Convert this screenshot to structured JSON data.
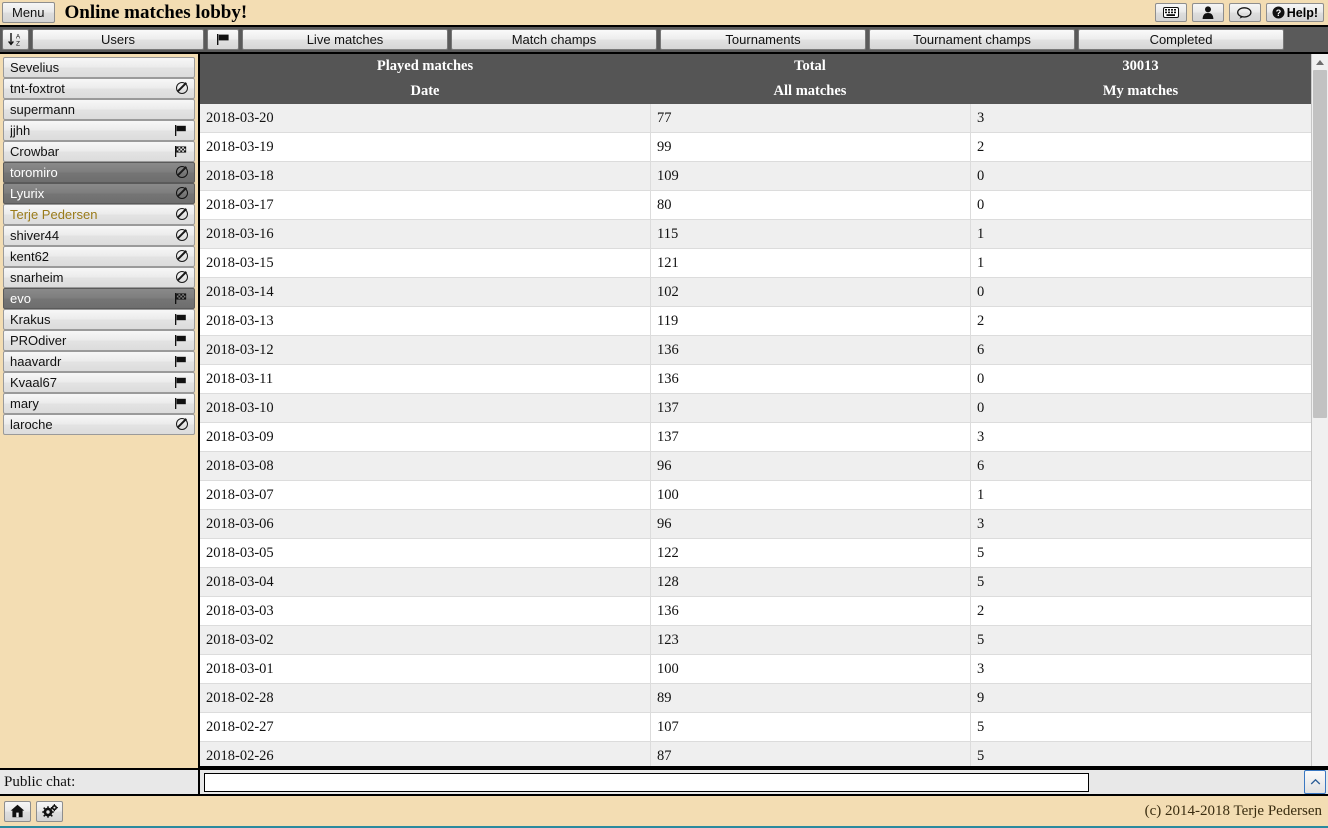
{
  "titlebar": {
    "menu_label": "Menu",
    "app_title": "Online matches lobby!",
    "help_label": "Help!",
    "icons": {
      "keyboard": "keyboard-icon",
      "user": "user-icon",
      "chat": "chat-bubble-icon",
      "help": "help-circle-icon"
    }
  },
  "tabs": {
    "sort_icon": "sort-alpha-down-icon",
    "users_label": "Users",
    "flag_icon": "flag-icon",
    "items": [
      {
        "label": "Live matches",
        "active": true
      },
      {
        "label": "Match champs",
        "active": false
      },
      {
        "label": "Tournaments",
        "active": false
      },
      {
        "label": "Tournament champs",
        "active": false
      },
      {
        "label": "Completed",
        "active": false
      }
    ]
  },
  "sidebar": {
    "users": [
      {
        "name": "Sevelius",
        "icon": "none",
        "selected": false,
        "highlight": false
      },
      {
        "name": "tnt-foxtrot",
        "icon": "no-entry",
        "selected": false,
        "highlight": false
      },
      {
        "name": "supermann",
        "icon": "none",
        "selected": false,
        "highlight": false
      },
      {
        "name": "jjhh",
        "icon": "flag",
        "selected": false,
        "highlight": false
      },
      {
        "name": "Crowbar",
        "icon": "checkered",
        "selected": false,
        "highlight": false
      },
      {
        "name": "toromiro",
        "icon": "no-entry",
        "selected": true,
        "highlight": false
      },
      {
        "name": "Lyurix",
        "icon": "no-entry",
        "selected": true,
        "highlight": false
      },
      {
        "name": "Terje Pedersen",
        "icon": "no-entry",
        "selected": false,
        "highlight": true
      },
      {
        "name": "shiver44",
        "icon": "no-entry",
        "selected": false,
        "highlight": false
      },
      {
        "name": "kent62",
        "icon": "no-entry",
        "selected": false,
        "highlight": false
      },
      {
        "name": "snarheim",
        "icon": "no-entry",
        "selected": false,
        "highlight": false
      },
      {
        "name": "evo",
        "icon": "checkered",
        "selected": true,
        "highlight": false
      },
      {
        "name": "Krakus",
        "icon": "flag",
        "selected": false,
        "highlight": false
      },
      {
        "name": "PROdiver",
        "icon": "flag",
        "selected": false,
        "highlight": false
      },
      {
        "name": "haavardr",
        "icon": "flag",
        "selected": false,
        "highlight": false
      },
      {
        "name": "Kvaal67",
        "icon": "flag",
        "selected": false,
        "highlight": false
      },
      {
        "name": "mary",
        "icon": "flag",
        "selected": false,
        "highlight": false
      },
      {
        "name": "laroche",
        "icon": "no-entry",
        "selected": false,
        "highlight": false
      }
    ]
  },
  "table": {
    "header_top": [
      "Played matches",
      "Total",
      "30013"
    ],
    "header_bottom": [
      "Date",
      "All matches",
      "My matches"
    ],
    "rows": [
      [
        "2018-03-20",
        "77",
        "3"
      ],
      [
        "2018-03-19",
        "99",
        "2"
      ],
      [
        "2018-03-18",
        "109",
        "0"
      ],
      [
        "2018-03-17",
        "80",
        "0"
      ],
      [
        "2018-03-16",
        "115",
        "1"
      ],
      [
        "2018-03-15",
        "121",
        "1"
      ],
      [
        "2018-03-14",
        "102",
        "0"
      ],
      [
        "2018-03-13",
        "119",
        "2"
      ],
      [
        "2018-03-12",
        "136",
        "6"
      ],
      [
        "2018-03-11",
        "136",
        "0"
      ],
      [
        "2018-03-10",
        "137",
        "0"
      ],
      [
        "2018-03-09",
        "137",
        "3"
      ],
      [
        "2018-03-08",
        "96",
        "6"
      ],
      [
        "2018-03-07",
        "100",
        "1"
      ],
      [
        "2018-03-06",
        "96",
        "3"
      ],
      [
        "2018-03-05",
        "122",
        "5"
      ],
      [
        "2018-03-04",
        "128",
        "5"
      ],
      [
        "2018-03-03",
        "136",
        "2"
      ],
      [
        "2018-03-02",
        "123",
        "5"
      ],
      [
        "2018-03-01",
        "100",
        "3"
      ],
      [
        "2018-02-28",
        "89",
        "9"
      ],
      [
        "2018-02-27",
        "107",
        "5"
      ],
      [
        "2018-02-26",
        "87",
        "5"
      ]
    ]
  },
  "chat": {
    "label": "Public chat:",
    "value": "",
    "placeholder": "",
    "scroll_up_icon": "chevron-up-icon"
  },
  "footer": {
    "home_icon": "home-icon",
    "settings_icon": "gears-icon",
    "copyright": "(c) 2014-2018 Terje Pedersen"
  },
  "colors": {
    "header_bg": "#f3ddb3",
    "tabbar_bg": "#5a5a5a",
    "table_head_bg": "#555555",
    "row_alt_bg": "#efefef",
    "selected_user_bg": "#7d7d7d",
    "highlight_text": "#9a7b1a",
    "accent_border": "#2a8a9e"
  }
}
